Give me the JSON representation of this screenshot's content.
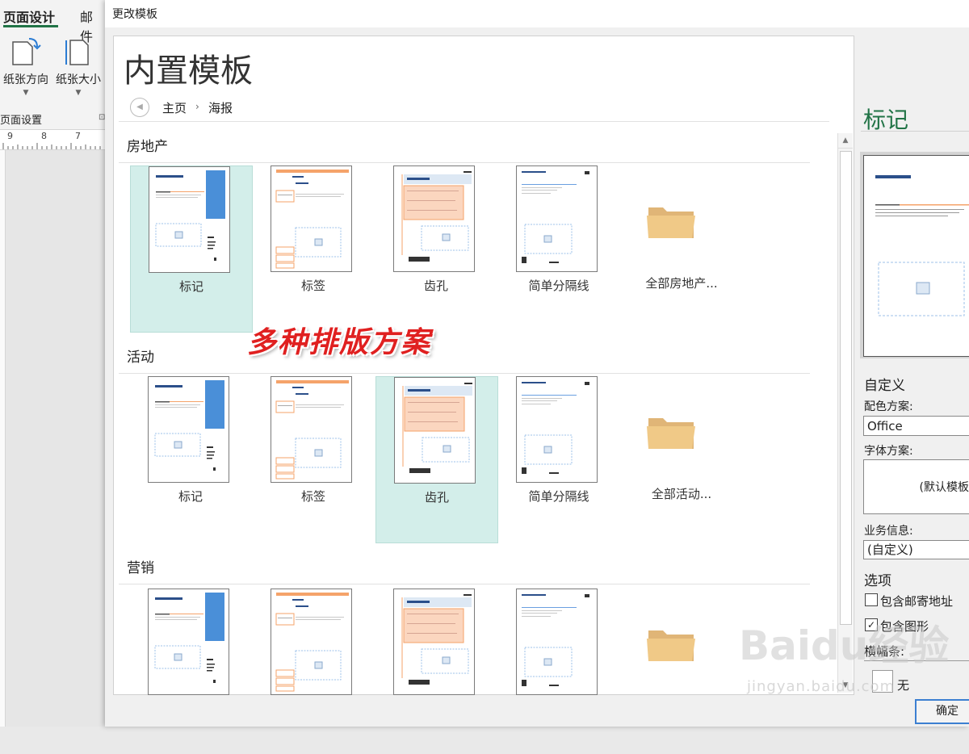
{
  "ribbon": {
    "tabs": [
      "页面设计",
      "邮件"
    ],
    "buttons": [
      {
        "label": "纸张方向",
        "icon": "page-orientation-icon"
      },
      {
        "label": "纸张大小",
        "icon": "page-size-icon"
      }
    ],
    "group_label": "页面设置",
    "ruler_numbers": [
      "9",
      "8",
      "7"
    ]
  },
  "dialog": {
    "title": "更改模板",
    "heading": "内置模板",
    "breadcrumb": {
      "home": "主页",
      "separator": "›",
      "current": "海报"
    },
    "sections": [
      {
        "title": "房地产",
        "items": [
          {
            "label": "标记",
            "selected": true,
            "style": "mark"
          },
          {
            "label": "标签",
            "selected": false,
            "style": "tag"
          },
          {
            "label": "齿孔",
            "selected": false,
            "style": "perf"
          },
          {
            "label": "简单分隔线",
            "selected": false,
            "style": "divider"
          }
        ],
        "folder_label": "全部房地产..."
      },
      {
        "title": "活动",
        "items": [
          {
            "label": "标记",
            "selected": false,
            "style": "mark"
          },
          {
            "label": "标签",
            "selected": false,
            "style": "tag"
          },
          {
            "label": "齿孔",
            "selected": true,
            "style": "perf"
          },
          {
            "label": "简单分隔线",
            "selected": false,
            "style": "divider"
          }
        ],
        "folder_label": "全部活动..."
      },
      {
        "title": "营销",
        "items": [
          {
            "label": "",
            "selected": false,
            "style": "mark"
          },
          {
            "label": "",
            "selected": false,
            "style": "tag"
          },
          {
            "label": "",
            "selected": false,
            "style": "perf"
          },
          {
            "label": "",
            "selected": false,
            "style": "divider"
          }
        ],
        "folder_label": ""
      }
    ],
    "overlay_text": "多种排版方案"
  },
  "preview": {
    "title": "标记",
    "customize_heading": "自定义",
    "color_scheme_label": "配色方案:",
    "color_scheme_value": "Office",
    "font_scheme_label": "字体方案:",
    "font_scheme_value": "(默认模板",
    "business_info_label": "业务信息:",
    "business_info_value": "(自定义)",
    "options_heading": "选项",
    "options": [
      {
        "label": "包含邮寄地址",
        "checked": false
      },
      {
        "label": "包含图形",
        "checked": true
      }
    ],
    "border_label": "横幅条:",
    "border_value": "无",
    "ok_label": "确定"
  },
  "watermark": {
    "logo": "Baidu经验",
    "url": "jingyan.baidu.com"
  },
  "colors": {
    "accent_green": "#217346",
    "selected_tile": "#d3eeea",
    "overlay_red": "#e02020",
    "folder": "#f0c987",
    "blue_bar": "#4a8fd8",
    "orange": "#f5a36a"
  }
}
